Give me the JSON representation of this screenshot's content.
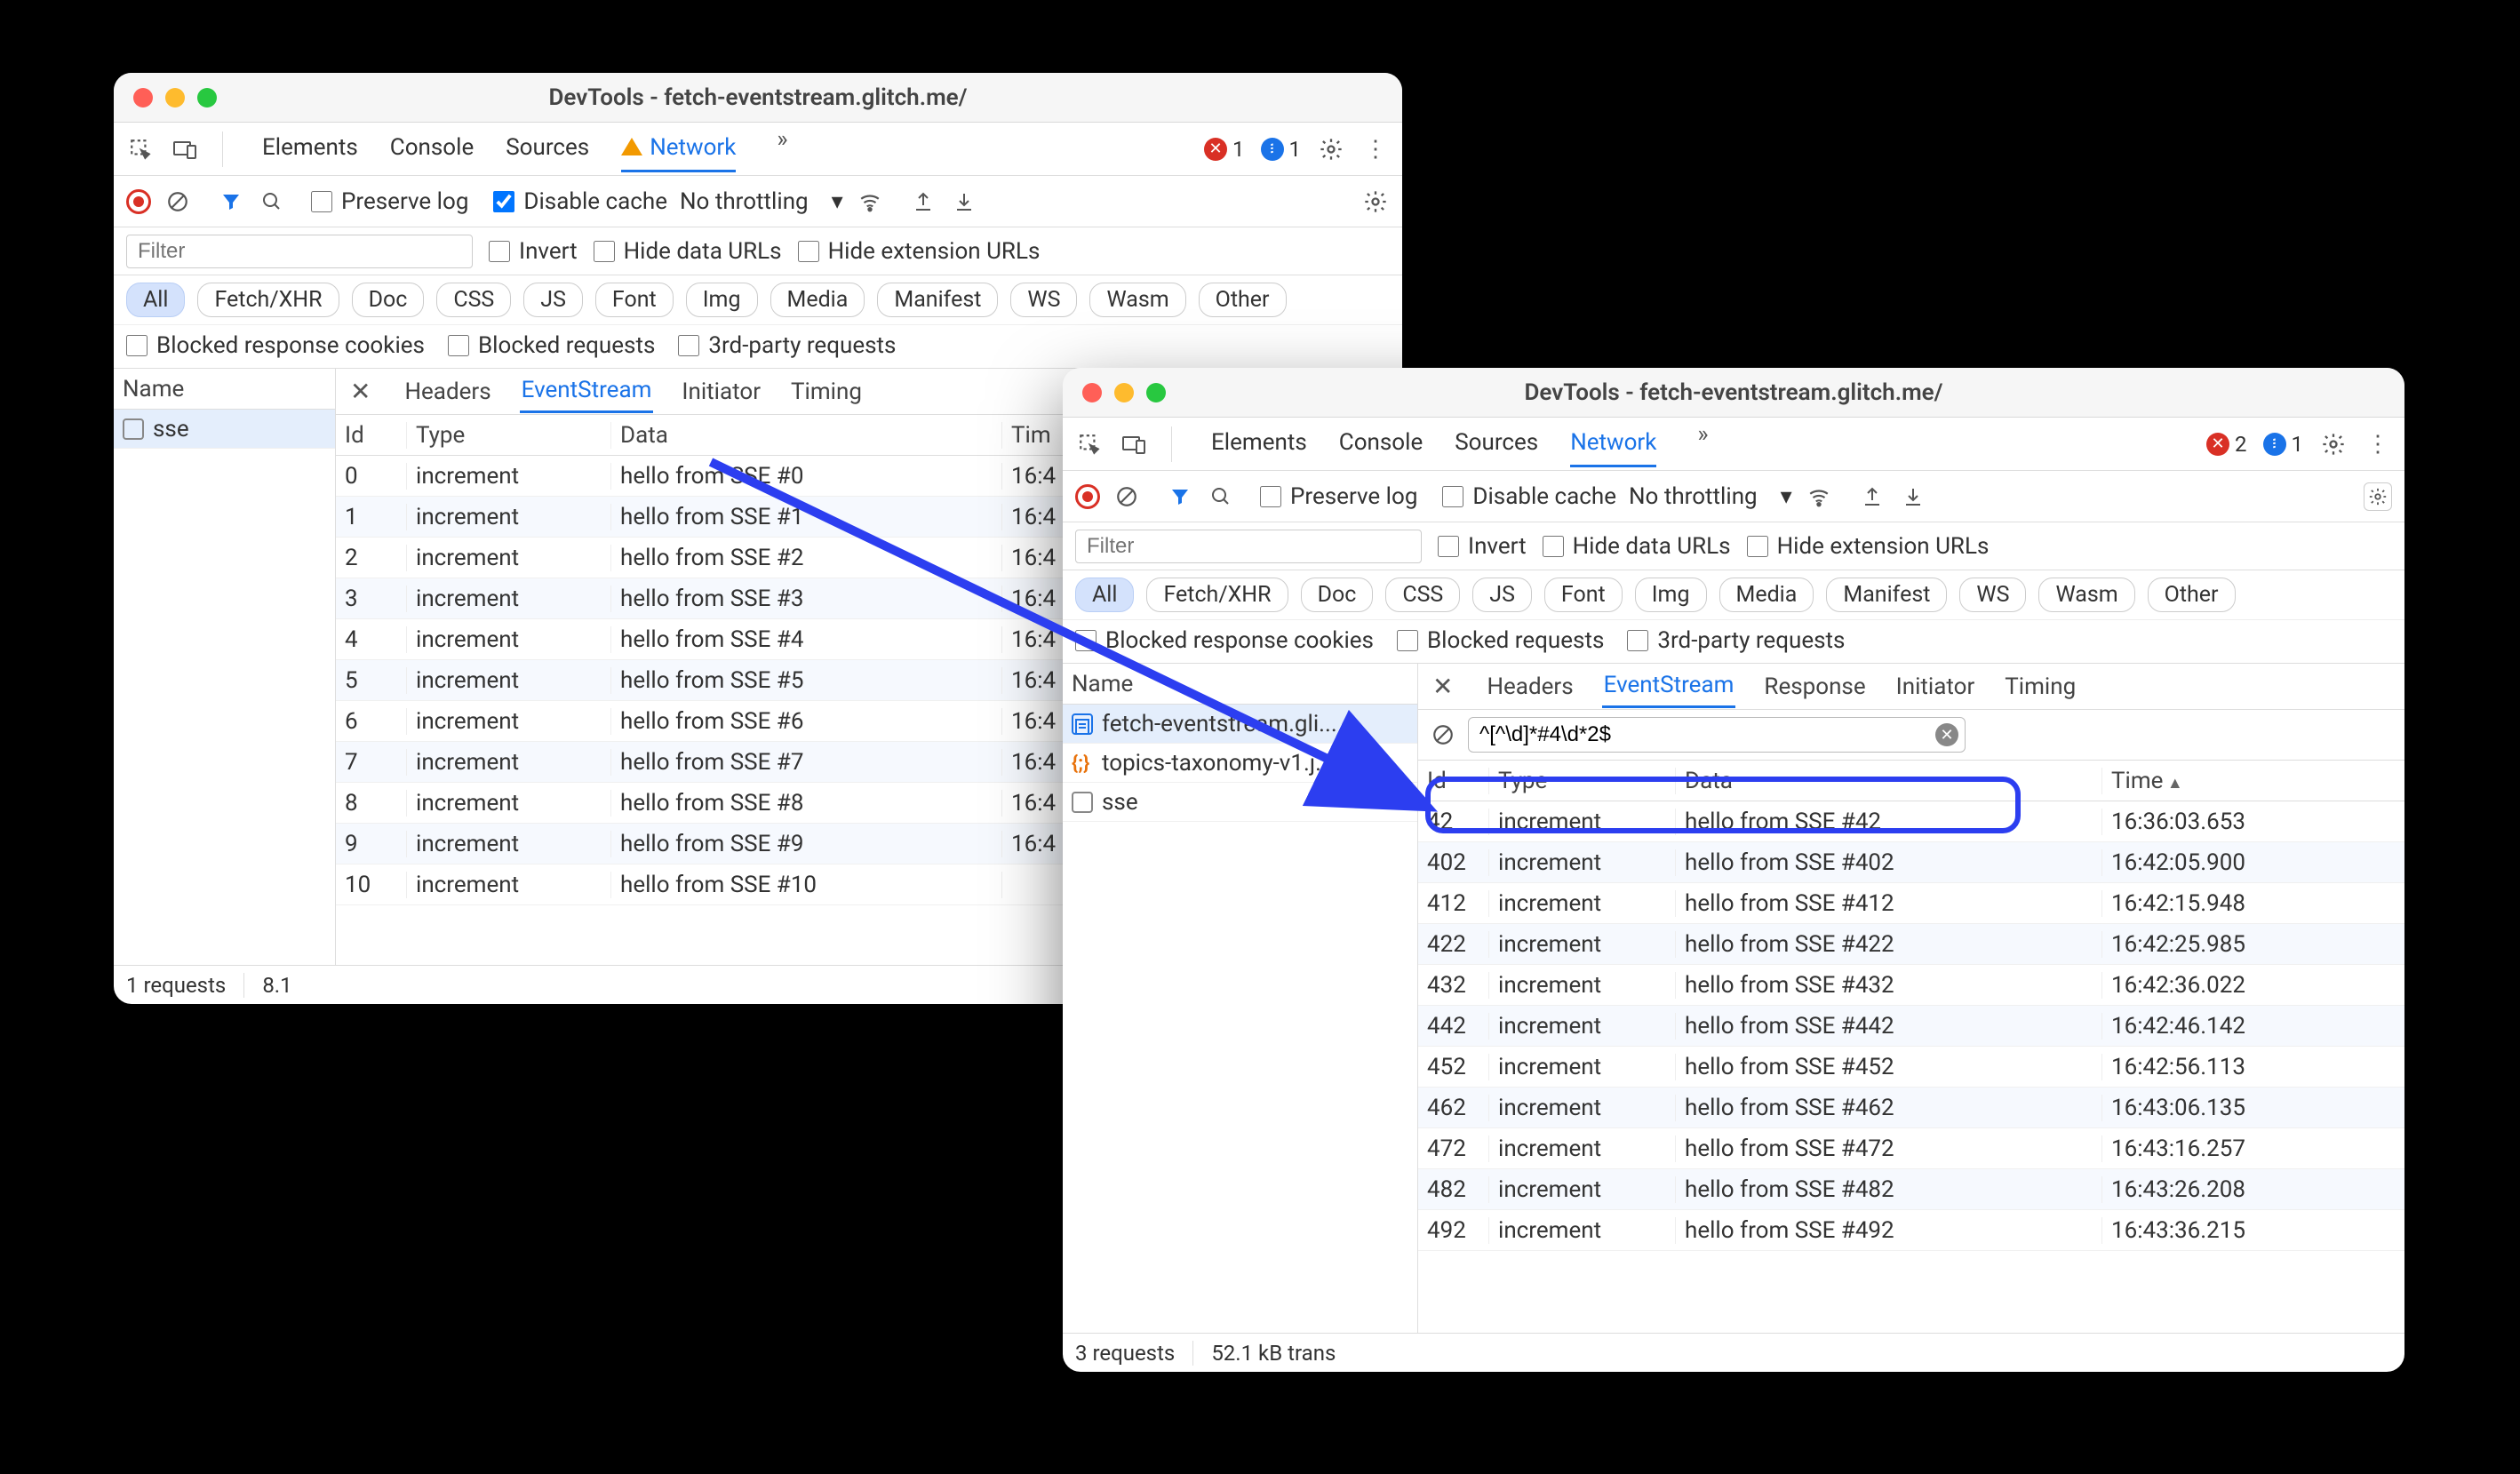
{
  "window1": {
    "title": "DevTools - fetch-eventstream.glitch.me/",
    "main_tabs": [
      "Elements",
      "Console",
      "Sources",
      "Network"
    ],
    "active_main_tab": "Network",
    "error_count": 1,
    "message_count": 1,
    "preserve_log": "Preserve log",
    "disable_cache": "Disable cache",
    "throttling": "No throttling",
    "filter_placeholder": "Filter",
    "invert": "Invert",
    "hide_data_urls": "Hide data URLs",
    "hide_ext_urls": "Hide extension URLs",
    "resource_types": [
      "All",
      "Fetch/XHR",
      "Doc",
      "CSS",
      "JS",
      "Font",
      "Img",
      "Media",
      "Manifest",
      "WS",
      "Wasm",
      "Other"
    ],
    "active_resource_type": "All",
    "blocked_cookies": "Blocked response cookies",
    "blocked_requests": "Blocked requests",
    "third_party": "3rd-party requests",
    "name_header": "Name",
    "requests": [
      {
        "name": "sse"
      }
    ],
    "detail_tabs": [
      "Headers",
      "EventStream",
      "Initiator",
      "Timing"
    ],
    "active_detail_tab": "EventStream",
    "columns": {
      "id": "Id",
      "type": "Type",
      "data": "Data",
      "time": "Tim"
    },
    "rows": [
      {
        "id": "0",
        "type": "increment",
        "data": "hello from SSE #0",
        "time": "16:4"
      },
      {
        "id": "1",
        "type": "increment",
        "data": "hello from SSE #1",
        "time": "16:4"
      },
      {
        "id": "2",
        "type": "increment",
        "data": "hello from SSE #2",
        "time": "16:4"
      },
      {
        "id": "3",
        "type": "increment",
        "data": "hello from SSE #3",
        "time": "16:4"
      },
      {
        "id": "4",
        "type": "increment",
        "data": "hello from SSE #4",
        "time": "16:4"
      },
      {
        "id": "5",
        "type": "increment",
        "data": "hello from SSE #5",
        "time": "16:4"
      },
      {
        "id": "6",
        "type": "increment",
        "data": "hello from SSE #6",
        "time": "16:4"
      },
      {
        "id": "7",
        "type": "increment",
        "data": "hello from SSE #7",
        "time": "16:4"
      },
      {
        "id": "8",
        "type": "increment",
        "data": "hello from SSE #8",
        "time": "16:4"
      },
      {
        "id": "9",
        "type": "increment",
        "data": "hello from SSE #9",
        "time": "16:4"
      },
      {
        "id": "10",
        "type": "increment",
        "data": "hello from SSE #10",
        "time": ""
      }
    ],
    "status": {
      "requests": "1 requests",
      "transfer": "8.1"
    }
  },
  "window2": {
    "title": "DevTools - fetch-eventstream.glitch.me/",
    "main_tabs": [
      "Elements",
      "Console",
      "Sources",
      "Network"
    ],
    "active_main_tab": "Network",
    "error_count": 2,
    "message_count": 1,
    "preserve_log": "Preserve log",
    "disable_cache": "Disable cache",
    "throttling": "No throttling",
    "filter_placeholder": "Filter",
    "invert": "Invert",
    "hide_data_urls": "Hide data URLs",
    "hide_ext_urls": "Hide extension URLs",
    "resource_types": [
      "All",
      "Fetch/XHR",
      "Doc",
      "CSS",
      "JS",
      "Font",
      "Img",
      "Media",
      "Manifest",
      "WS",
      "Wasm",
      "Other"
    ],
    "active_resource_type": "All",
    "blocked_cookies": "Blocked response cookies",
    "blocked_requests": "Blocked requests",
    "third_party": "3rd-party requests",
    "name_header": "Name",
    "requests": [
      {
        "name": "fetch-eventstream.gli...",
        "icon": "doc",
        "selected": true
      },
      {
        "name": "topics-taxonomy-v1.j...",
        "icon": "json"
      },
      {
        "name": "sse",
        "icon": "empty"
      }
    ],
    "detail_tabs": [
      "Headers",
      "EventStream",
      "Response",
      "Initiator",
      "Timing"
    ],
    "active_detail_tab": "EventStream",
    "es_filter": "^[^\\d]*#4\\d*2$",
    "columns": {
      "id": "Id",
      "type": "Type",
      "data": "Data",
      "time": "Time"
    },
    "rows": [
      {
        "id": "42",
        "type": "increment",
        "data": "hello from SSE #42",
        "time": "16:36:03.653"
      },
      {
        "id": "402",
        "type": "increment",
        "data": "hello from SSE #402",
        "time": "16:42:05.900"
      },
      {
        "id": "412",
        "type": "increment",
        "data": "hello from SSE #412",
        "time": "16:42:15.948"
      },
      {
        "id": "422",
        "type": "increment",
        "data": "hello from SSE #422",
        "time": "16:42:25.985"
      },
      {
        "id": "432",
        "type": "increment",
        "data": "hello from SSE #432",
        "time": "16:42:36.022"
      },
      {
        "id": "442",
        "type": "increment",
        "data": "hello from SSE #442",
        "time": "16:42:46.142"
      },
      {
        "id": "452",
        "type": "increment",
        "data": "hello from SSE #452",
        "time": "16:42:56.113"
      },
      {
        "id": "462",
        "type": "increment",
        "data": "hello from SSE #462",
        "time": "16:43:06.135"
      },
      {
        "id": "472",
        "type": "increment",
        "data": "hello from SSE #472",
        "time": "16:43:16.257"
      },
      {
        "id": "482",
        "type": "increment",
        "data": "hello from SSE #482",
        "time": "16:43:26.208"
      },
      {
        "id": "492",
        "type": "increment",
        "data": "hello from SSE #492",
        "time": "16:43:36.215"
      }
    ],
    "status": {
      "requests": "3 requests",
      "transfer": "52.1 kB trans"
    }
  }
}
